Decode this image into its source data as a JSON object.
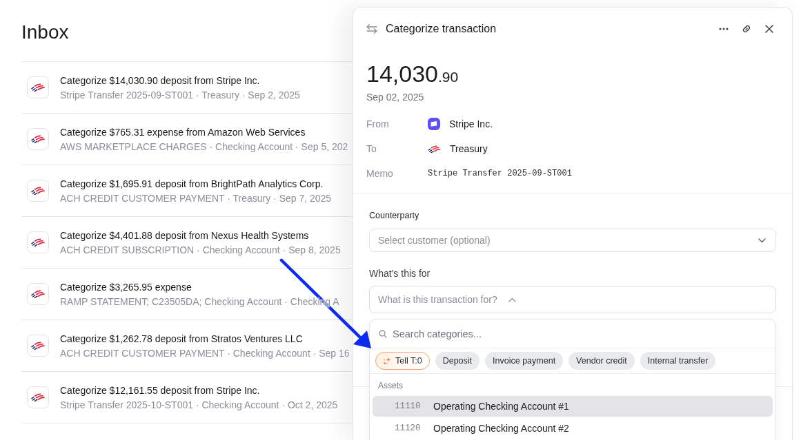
{
  "inbox": {
    "title": "Inbox",
    "items": [
      {
        "title": "Categorize $14,030.90 deposit from Stripe Inc.",
        "subtitle": "Stripe Transfer 2025-09-ST001 · Treasury · Sep 2, 2025"
      },
      {
        "title": "Categorize $765.31 expense from Amazon Web Services",
        "subtitle": "AWS MARKETPLACE CHARGES · Checking Account · Sep 5, 202"
      },
      {
        "title": "Categorize $1,695.91 deposit from BrightPath Analytics Corp.",
        "subtitle": "ACH CREDIT CUSTOMER PAYMENT · Treasury · Sep 7, 2025"
      },
      {
        "title": "Categorize $4,401.88 deposit from Nexus Health Systems",
        "subtitle": "ACH CREDIT SUBSCRIPTION · Checking Account · Sep 8, 2025"
      },
      {
        "title": "Categorize $3,265.95 expense",
        "subtitle": "RAMP STATEMENT; C23505DA; Checking Account · Checking A"
      },
      {
        "title": "Categorize $1,262.78 deposit from Stratos Ventures LLC",
        "subtitle": "ACH CREDIT CUSTOMER PAYMENT · Checking Account · Sep 16"
      },
      {
        "title": "Categorize $12,161.55 deposit from Stripe Inc.",
        "subtitle": "Stripe Transfer 2025-10-ST001 · Checking Account · Oct 2, 2025"
      }
    ]
  },
  "panel": {
    "title": "Categorize transaction",
    "amount": {
      "whole": "14,030",
      "fraction": ".90"
    },
    "date": "Sep 02, 2025",
    "details": [
      {
        "label": "From",
        "value": "Stripe Inc.",
        "kind": "company"
      },
      {
        "label": "To",
        "value": "Treasury",
        "kind": "bank"
      },
      {
        "label": "Memo",
        "value": "Stripe Transfer 2025-09-ST001",
        "kind": "memo"
      }
    ],
    "counterparty": {
      "label": "Counterparty",
      "placeholder": "Select customer (optional)"
    },
    "purpose": {
      "label": "What's this for",
      "placeholder": "What is this transaction for?",
      "expanded": true
    },
    "category_menu": {
      "search_placeholder": "Search categories...",
      "chips": [
        {
          "label": "Tell T:0",
          "kind": "assistant"
        },
        {
          "label": "Deposit",
          "kind": "preset"
        },
        {
          "label": "Invoice payment",
          "kind": "preset"
        },
        {
          "label": "Vendor credit",
          "kind": "preset"
        },
        {
          "label": "Internal transfer",
          "kind": "preset"
        }
      ],
      "groups": [
        {
          "title": "Assets",
          "items": [
            {
              "code": "11110",
              "name": "Operating Checking Account #1",
              "selected": true
            },
            {
              "code": "11120",
              "name": "Operating Checking Account #2",
              "selected": false
            }
          ]
        }
      ]
    }
  }
}
